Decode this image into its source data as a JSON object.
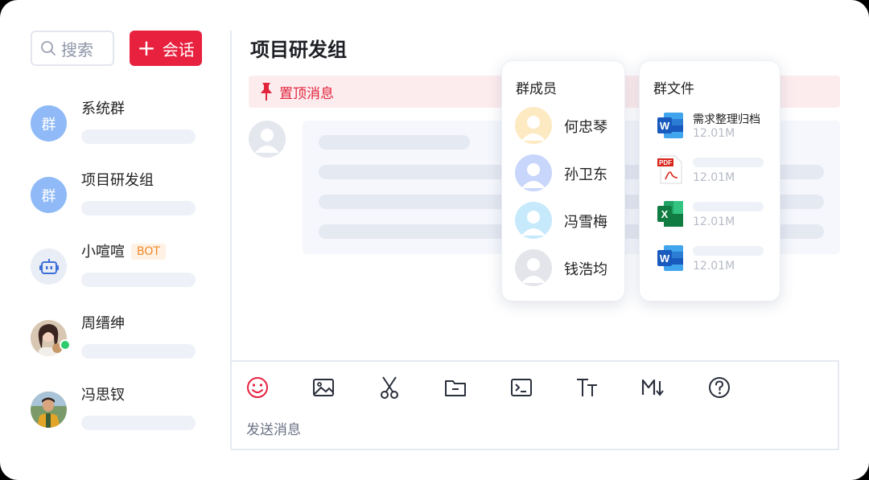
{
  "sidebar": {
    "search_placeholder": "搜索",
    "new_chat_label": "会话",
    "conversations": [
      {
        "name": "系统群",
        "avatar_text": "群"
      },
      {
        "name": "项目研发组",
        "avatar_text": "群"
      },
      {
        "name": "小喧喧",
        "badge": "BOT"
      },
      {
        "name": "周缙绅"
      },
      {
        "name": "冯思钗"
      }
    ]
  },
  "chat": {
    "title": "项目研发组",
    "pinned_label": "置顶消息",
    "composer_placeholder": "发送消息"
  },
  "members_popup": {
    "title": "群成员",
    "members": [
      "何忠琴",
      "孙卫东",
      "冯雪梅",
      "钱浩均"
    ]
  },
  "files_popup": {
    "title": "群文件",
    "files": [
      {
        "type": "word",
        "name": "需求整理归档",
        "size": "12.01M"
      },
      {
        "type": "pdf",
        "size": "12.01M",
        "icon_label": "PDF"
      },
      {
        "type": "excel",
        "size": "12.01M",
        "icon_label": "X"
      },
      {
        "type": "word",
        "size": "12.01M",
        "icon_label": "W"
      }
    ],
    "word_icon_label": "W"
  },
  "toolbar": [
    "emoji-icon",
    "image-icon",
    "scissors-icon",
    "folder-icon",
    "terminal-icon",
    "text-format-icon",
    "markdown-icon",
    "help-icon"
  ],
  "colors": {
    "accent": "#e8213f",
    "group_avatar": "#8fbaf7",
    "bot_badge": "#f0892b"
  }
}
